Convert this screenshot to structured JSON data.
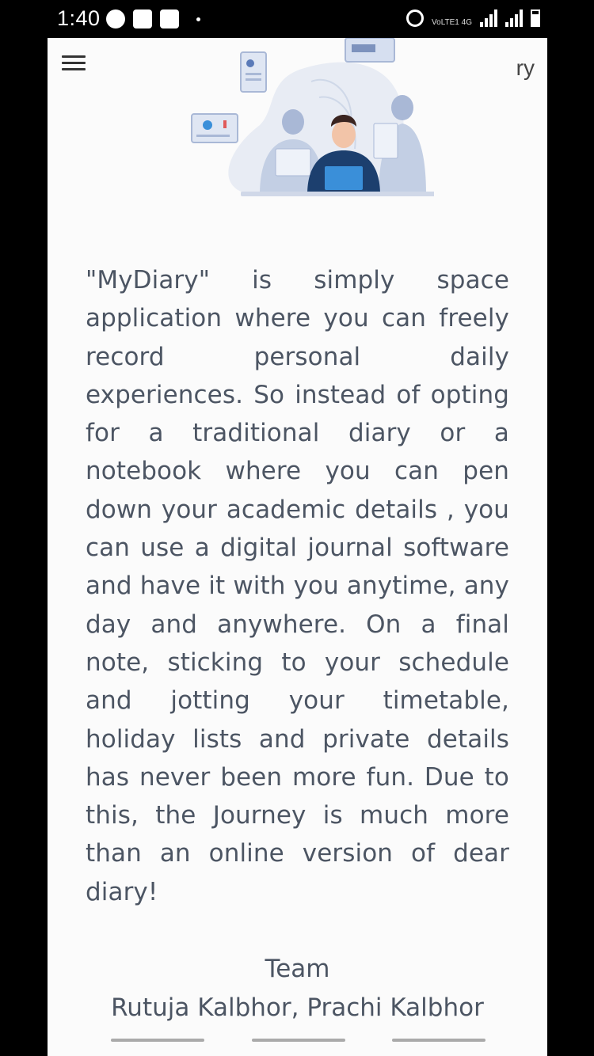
{
  "status_bar": {
    "time": "1:40",
    "network_label": "VoLTE1 4G"
  },
  "header": {
    "title_visible": "ry",
    "menu_icon": "hamburger-menu-icon"
  },
  "hero": {
    "illustration": "team-working-illustration"
  },
  "content": {
    "description": "\"MyDiary\" is simply space application where you can freely record personal daily experiences. So instead of opting for a traditional diary or a notebook where you can pen down your academic details , you can use a digital journal software and have it with you anytime, any day and anywhere. On a final note, sticking to your schedule and jotting your timetable, holiday lists and private details has never been more fun. Due to this, the Journey is much more than an online version of dear diary!",
    "team_heading": "Team",
    "team_members": "Rutuja Kalbhor, Prachi Kalbhor"
  },
  "colors": {
    "body_text": "#4c5563",
    "illustration_blue": "#a9b8d6",
    "accent_blue": "#3a8fd9",
    "shirt_dark": "#1c3f6e"
  }
}
